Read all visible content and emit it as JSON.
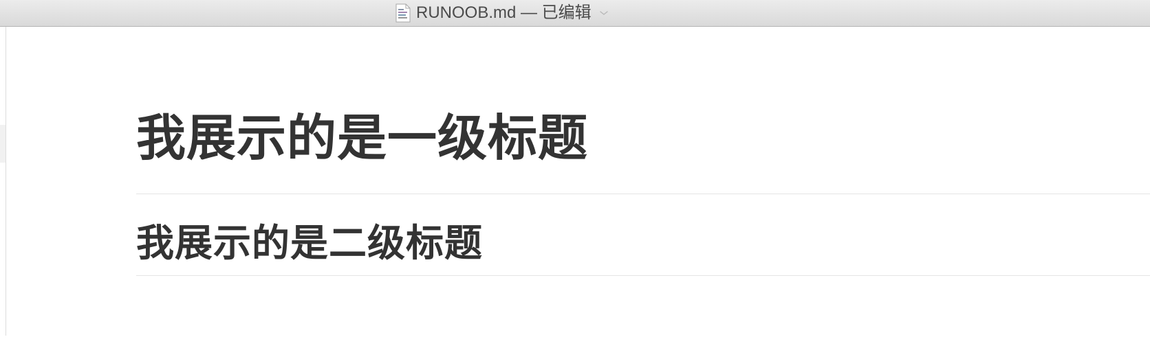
{
  "window": {
    "title": "RUNOOB.md — 已编辑",
    "file_icon": "document-icon",
    "menu_indicator_icon": "chevron-down-icon"
  },
  "document": {
    "h1": "我展示的是一级标题",
    "h2": "我展示的是二级标题"
  },
  "colors": {
    "heading_text": "#333333",
    "titlebar_top": "#ececec",
    "titlebar_bottom": "#d9d9d9",
    "divider": "#e5e5e5"
  }
}
